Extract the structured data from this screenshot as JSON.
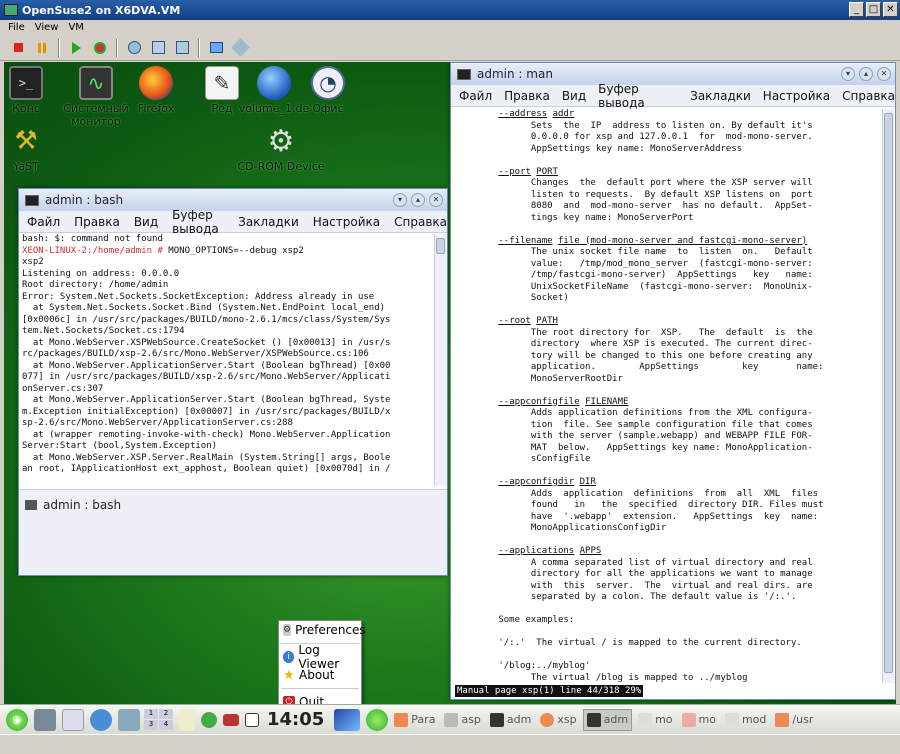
{
  "vm": {
    "title": "OpenSuse2 on X6DVA.VM",
    "menu": [
      "File",
      "View",
      "VM"
    ],
    "toolbar_buttons": [
      "stop-icon",
      "pause-icon",
      "play-icon",
      "reset-icon",
      "snapshot-icon",
      "revert-icon",
      "manage-snapshots-icon",
      "send-icon",
      "settings-icon"
    ]
  },
  "desktop_icons": [
    {
      "label": "Конс",
      "icon": "terminal-icon"
    },
    {
      "label": "Системный монитор",
      "icon": "system-monitor-icon"
    },
    {
      "label": "Firefox",
      "icon": "firefox-icon"
    },
    {
      "label": "Ред",
      "icon": "editor-icon"
    },
    {
      "label": "volume_1.de",
      "icon": "globe-icon"
    },
    {
      "label": "Офис",
      "icon": "office-icon"
    },
    {
      "label": "YaST",
      "icon": "yast-icon"
    },
    {
      "label": "CD-ROM Device",
      "icon": "cdrom-icon"
    }
  ],
  "bash_window": {
    "title": "admin : bash",
    "menu": [
      "Файл",
      "Правка",
      "Вид",
      "Буфер вывода",
      "Закладки",
      "Настройка",
      "Справка"
    ],
    "prompt_host": "XEON-LINUX-2:/home/admin #",
    "lines": [
      "bash: $: command not found",
      " MONO_OPTIONS=--debug xsp2",
      "xsp2",
      "Listening on address: 0.0.0.0",
      "Root directory: /home/admin",
      "Error: System.Net.Sockets.SocketException: Address already in use",
      "  at System.Net.Sockets.Socket.Bind (System.Net.EndPoint local_end)",
      "[0x0006c] in /usr/src/packages/BUILD/mono-2.6.1/mcs/class/System/Sys",
      "tem.Net.Sockets/Socket.cs:1794",
      "  at Mono.WebServer.XSPWebSource.CreateSocket () [0x00013] in /usr/s",
      "rc/packages/BUILD/xsp-2.6/src/Mono.WebServer/XSPWebSource.cs:106",
      "  at Mono.WebServer.ApplicationServer.Start (Boolean bgThread) [0x00",
      "077] in /usr/src/packages/BUILD/xsp-2.6/src/Mono.WebServer/Applicati",
      "onServer.cs:307",
      "  at Mono.WebServer.ApplicationServer.Start (Boolean bgThread, Syste",
      "m.Exception initialException) [0x00007] in /usr/src/packages/BUILD/x",
      "sp-2.6/src/Mono.WebServer/ApplicationServer.cs:288",
      "  at (wrapper remoting-invoke-with-check) Mono.WebServer.Application",
      "Server:Start (bool,System.Exception)",
      "  at Mono.WebServer.XSP.Server.RealMain (System.String[] args, Boole",
      "an root, IApplicationHost ext_apphost, Boolean quiet) [0x0070d] in /"
    ],
    "tab_label": "admin : bash"
  },
  "man_window": {
    "title": "admin : man",
    "menu": [
      "Файл",
      "Правка",
      "Вид",
      "Буфер вывода",
      "Закладки",
      "Настройка",
      "Справка"
    ],
    "sections": [
      {
        "opt": "--address",
        "arg": "addr",
        "body": [
          "Sets  the  IP  address to listen on. By default it's",
          "0.0.0.0 for xsp and 127.0.0.1  for  mod-mono-server.",
          "AppSettings key name: MonoServerAddress"
        ]
      },
      {
        "opt": "--port",
        "arg": "PORT",
        "body": [
          "Changes  the  default port where the XSP server will",
          "listen to requests.  By default XSP listens on  port",
          "8080  and  mod-mono-server  has no default.  AppSet-",
          "tings key name: MonoServerPort"
        ]
      },
      {
        "opt": "--filename",
        "arg": "file (mod-mono-server and fastcgi-mono-server)",
        "body": [
          "The unix socket file name  to  listen  on.   Default",
          "value:   /tmp/mod_mono_server  (fastcgi-mono-server:",
          "/tmp/fastcgi-mono-server)  AppSettings   key   name:",
          "UnixSocketFileName  (fastcgi-mono-server:  MonoUnix-",
          "Socket)"
        ]
      },
      {
        "opt": "--root",
        "arg": "PATH",
        "body": [
          "The root directory for  XSP.   The  default  is  the",
          "directory  where XSP is executed. The current direc-",
          "tory will be changed to this one before creating any",
          "application.        AppSettings        key       name:",
          "MonoServerRootDir"
        ]
      },
      {
        "opt": "--appconfigfile",
        "arg": "FILENAME",
        "body": [
          "Adds application definitions from the XML configura-",
          "tion  file. See sample configuration file that comes",
          "with the server (sample.webapp) and WEBAPP FILE FOR-",
          "MAT  below.   AppSettings key name: MonoApplication-",
          "sConfigFile"
        ]
      },
      {
        "opt": "--appconfigdir",
        "arg": "DIR",
        "body": [
          "Adds  application  definitions  from  all  XML  files",
          "found   in   the  specified  directory DIR. Files must",
          "have  '.webapp'  extension.   AppSettings  key  name:",
          "MonoApplicationsConfigDir"
        ]
      },
      {
        "opt": "--applications",
        "arg": "APPS",
        "body": [
          "A comma separated list of virtual directory and real",
          "directory for all the applications we want to manage",
          "with  this  server.  The  virtual and real dirs. are",
          "separated by a colon. The default value is '/:.'."
        ]
      }
    ],
    "examples_heading": "Some examples:",
    "example1": "'/:.'  The virtual / is mapped to the current directory.",
    "example2_cmd": "'/blog:../myblog'",
    "example2_body": "The virtual /blog is mapped to ../myblog",
    "statusline": "Manual page xsp(1) line 44/318 29%"
  },
  "context_menu": {
    "items": [
      "Preferences",
      "Log Viewer",
      "About",
      "Quit"
    ]
  },
  "panel": {
    "clock": "14:05",
    "pager": [
      "1",
      "2",
      "3",
      "4"
    ],
    "tasks": [
      "Para",
      "asp",
      "adm",
      "xsp",
      "adm",
      "mo",
      "mo",
      "mod",
      "/usr"
    ]
  }
}
